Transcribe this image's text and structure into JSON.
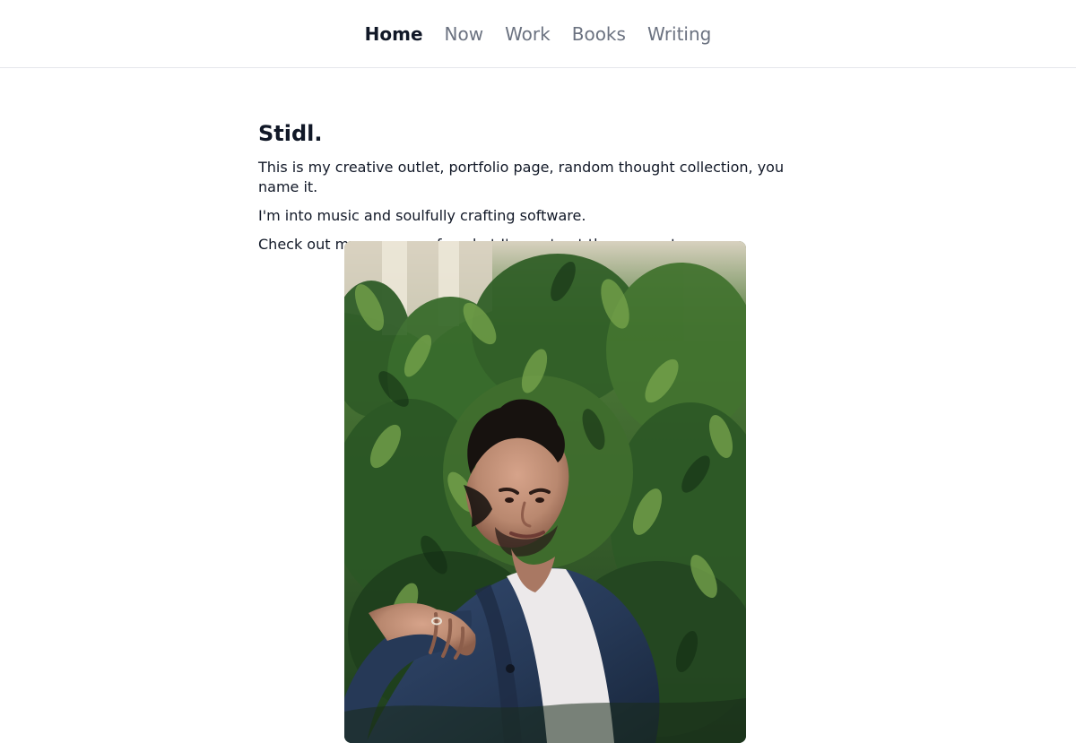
{
  "nav": {
    "items": [
      {
        "label": "Home",
        "active": true
      },
      {
        "label": "Now",
        "active": false
      },
      {
        "label": "Work",
        "active": false
      },
      {
        "label": "Books",
        "active": false
      },
      {
        "label": "Writing",
        "active": false
      }
    ]
  },
  "main": {
    "title": "Stidl.",
    "line_1": "This is my creative outlet, portfolio page, random thought collection, you name it.",
    "line_2": "I'm into music and soulfully crafting software.",
    "line_3_before": "Check out my ",
    "line_3_link": "now",
    "line_3_after": " page for what I'm up to at the moment."
  },
  "portrait": {
    "alt": "Portrait photograph",
    "colors": {
      "foliage_dark": "#1f3f1b",
      "foliage_mid": "#3e6f2d",
      "foliage_light": "#7ca34e",
      "jacket": "#263957",
      "shirt": "#ece9ea",
      "skin": "#b9886f",
      "hair": "#17120f"
    }
  },
  "colors": {
    "link": "#2563eb",
    "text": "#111827",
    "muted_nav": "#6b7280",
    "divider": "#e5e7eb"
  }
}
